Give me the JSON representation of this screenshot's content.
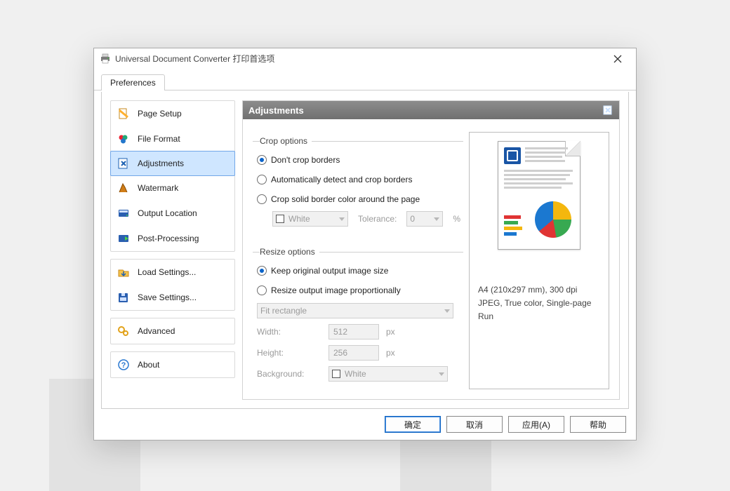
{
  "title": "Universal Document Converter 打印首选项",
  "tab": {
    "label": "Preferences"
  },
  "sidebar": {
    "groups": [
      {
        "items": [
          {
            "id": "page-setup",
            "label": "Page Setup"
          },
          {
            "id": "file-format",
            "label": "File Format"
          },
          {
            "id": "adjustments",
            "label": "Adjustments",
            "selected": true
          },
          {
            "id": "watermark",
            "label": "Watermark"
          },
          {
            "id": "output-location",
            "label": "Output Location"
          },
          {
            "id": "post-processing",
            "label": "Post-Processing"
          }
        ]
      },
      {
        "items": [
          {
            "id": "load-settings",
            "label": "Load Settings..."
          },
          {
            "id": "save-settings",
            "label": "Save Settings..."
          }
        ]
      },
      {
        "items": [
          {
            "id": "advanced",
            "label": "Advanced"
          }
        ]
      },
      {
        "items": [
          {
            "id": "about",
            "label": "About"
          }
        ]
      }
    ]
  },
  "main": {
    "header": "Adjustments",
    "crop": {
      "legend": "Crop options",
      "opt_none": "Don't crop borders",
      "opt_auto": "Automatically detect and crop borders",
      "opt_solid": "Crop solid border color around the page",
      "selected": "none",
      "color_name": "White",
      "tolerance_label": "Tolerance:",
      "tolerance_value": "0",
      "tolerance_unit": "%"
    },
    "resize": {
      "legend": "Resize options",
      "opt_keep": "Keep original output image size",
      "opt_resize": "Resize output image proportionally",
      "selected": "keep",
      "fit_mode": "Fit rectangle",
      "width_label": "Width:",
      "width_value": "512",
      "width_unit": "px",
      "height_label": "Height:",
      "height_value": "256",
      "height_unit": "px",
      "bg_label": "Background:",
      "bg_name": "White"
    }
  },
  "preview": {
    "line1": "A4 (210x297 mm), 300 dpi",
    "line2": "JPEG, True color, Single-page",
    "line3": "Run"
  },
  "buttons": {
    "ok": "确定",
    "cancel": "取消",
    "apply": "应用(A)",
    "help": "帮助"
  }
}
